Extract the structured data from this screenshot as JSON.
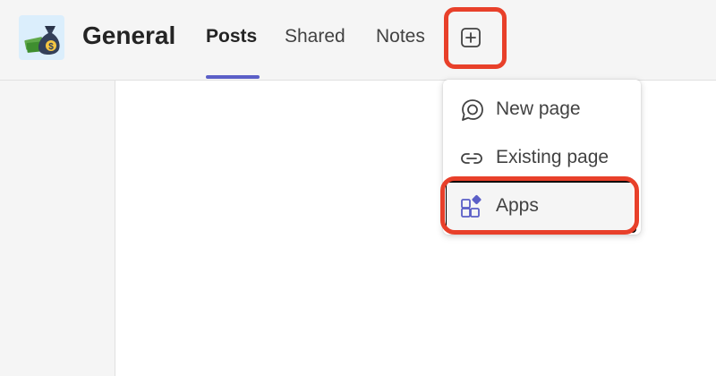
{
  "channel": {
    "title": "General",
    "avatar_icon": "money-bag-icon"
  },
  "tabs": [
    {
      "label": "Posts",
      "active": true
    },
    {
      "label": "Shared",
      "active": false
    },
    {
      "label": "Notes",
      "active": false
    }
  ],
  "add_tab": {
    "icon": "add-tab-icon"
  },
  "menu": {
    "items": [
      {
        "label": "New page",
        "icon": "loop-page-icon"
      },
      {
        "label": "Existing page",
        "icon": "link-icon"
      },
      {
        "label": "Apps",
        "icon": "apps-icon",
        "highlighted": true
      }
    ]
  },
  "colors": {
    "accent": "#5b5fc7",
    "annotation": "#e8402a"
  }
}
